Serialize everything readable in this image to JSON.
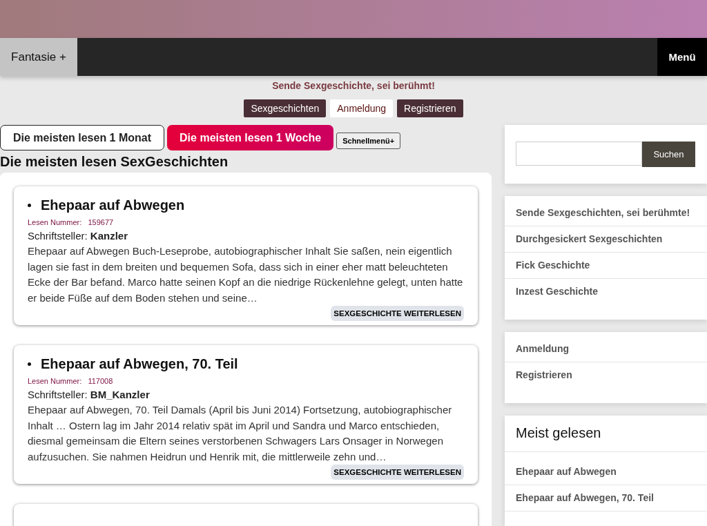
{
  "header": {
    "brand": "Fantasie +",
    "menu": "Menü"
  },
  "tagline": "Sende Sexgeschichte, sei berühmt!",
  "top_links": [
    {
      "label": "Sexgeschichten",
      "selected": false
    },
    {
      "label": "Anmeldung",
      "selected": true
    },
    {
      "label": "Registrieren",
      "selected": false
    }
  ],
  "tabs": [
    {
      "label": "Die meisten lesen 1 Monat",
      "selected": false
    },
    {
      "label": "Die meisten lesen 1 Woche",
      "selected": true
    }
  ],
  "quick_menu": "Schnellmenü+",
  "heading": "Die meisten lesen SexGeschichten",
  "stories": [
    {
      "title": "Ehepaar auf Abwegen",
      "number_label": "Lesen Nummer:",
      "number": "159677",
      "author_label": "Schriftsteller:",
      "author": "Kanzler",
      "excerpt": "Ehepaar auf Abwegen Buch-Leseprobe, autobiographischer Inhalt Sie saßen, nein eigentlich lagen sie fast in dem breiten und bequemen Sofa, dass sich in einer eher matt beleuchteten Ecke der Bar befand. Marco hatte seinen Kopf an die niedrige Rückenlehne gelegt, unten hatte er beide Füße auf dem Boden stehen und seine…",
      "button": "SEXGESCHICHTE WEITERLESEN"
    },
    {
      "title": "Ehepaar auf Abwegen, 70. Teil",
      "number_label": "Lesen Nummer:",
      "number": "117008",
      "author_label": "Schriftsteller:",
      "author": "BM_Kanzler",
      "excerpt": "Ehepaar auf Abwegen, 70. Teil Damals (April bis Juni 2014) Fortsetzung, autobiographischer Inhalt … Ostern lag im Jahr 2014 relativ spät im April und Sandra und Marco entschieden, diesmal gemeinsam die Eltern seines verstorbenen Schwagers Lars Onsager in Norwegen aufzusuchen. Sie nahmen Heidrun und Henrik mit, die mittlerweile zehn und…",
      "button": "SEXGESCHICHTE WEITERLESEN"
    }
  ],
  "search": {
    "button": "Suchen"
  },
  "sidebar_links": [
    "Sende Sexgeschichten, sei berühmte!",
    "Durchgesickert Sexgeschichten",
    "Fick Geschichte",
    "Inzest Geschichte"
  ],
  "account_links": [
    "Anmeldung",
    "Registrieren"
  ],
  "most_read": {
    "title": "Meist gelesen",
    "items": [
      "Ehepaar auf Abwegen",
      "Ehepaar auf Abwegen, 70. Teil"
    ]
  }
}
